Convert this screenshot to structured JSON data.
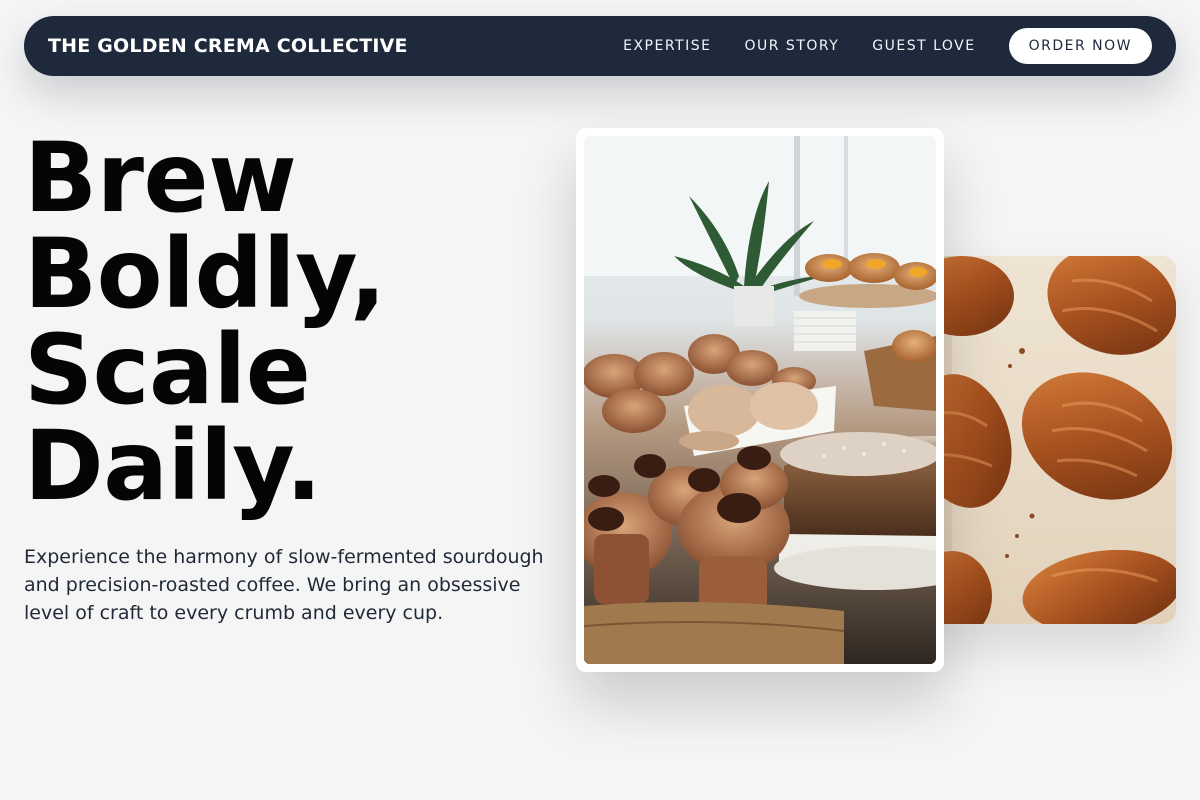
{
  "nav": {
    "brand": "THE GOLDEN CREMA COLLECTIVE",
    "links": [
      "EXPERTISE",
      "OUR STORY",
      "GUEST LOVE"
    ],
    "cta": "ORDER NOW"
  },
  "hero": {
    "headline": [
      "Brew",
      "Boldly,",
      "Scale",
      "Daily."
    ],
    "subtext": "Experience the harmony of slow-fermented sourdough and precision-roasted coffee. We bring an obsessive level of craft to every crumb and every cup."
  },
  "colors": {
    "nav_bg": "#1e293b",
    "page_bg": "#f5f5f5",
    "text": "#050505"
  },
  "images": {
    "front": "pastry-display-photo",
    "back": "croissants-photo"
  }
}
